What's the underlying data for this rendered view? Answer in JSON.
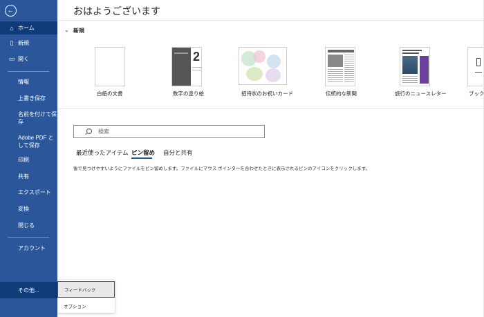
{
  "sidebar": {
    "back_icon": "←",
    "home_label": "ホーム",
    "new_label": "新規",
    "open_label": "開く",
    "info_label": "情報",
    "save_label": "上書き保存",
    "save_as_label": "名前を付けて保存",
    "adobe_pdf_label": "Adobe PDF として保存",
    "print_label": "印刷",
    "share_label": "共有",
    "export_label": "エクスポート",
    "transform_label": "変換",
    "close_label": "閉じる",
    "account_label": "アカウント",
    "more_label": "その他..."
  },
  "main": {
    "greeting": "おはようございます",
    "section_toggle": "⌄",
    "section_title": "新規",
    "templates": [
      {
        "label": "白紙の文書"
      },
      {
        "label": "数字の塗り絵"
      },
      {
        "label": "招待状のお祝いカード"
      },
      {
        "label": "伝統的な新聞"
      },
      {
        "label": "旅行のニュースレター"
      },
      {
        "label": "ブックマ"
      }
    ],
    "search_placeholder": "検索",
    "tabs": [
      {
        "label": "最近使ったアイテム"
      },
      {
        "label": "ピン留め"
      },
      {
        "label": "自分と共有"
      }
    ],
    "hint": "後で見つけやすいようにファイルをピン留めします。ファイルにマウス ポインターを合わせたときに表示されるピンのアイコンをクリックします。"
  },
  "popup": {
    "feedback_label": "フィードバック",
    "options_label": "オプション"
  },
  "colors": {
    "sidebar_bg": "#2b579a",
    "sidebar_active": "#0f3b79"
  }
}
